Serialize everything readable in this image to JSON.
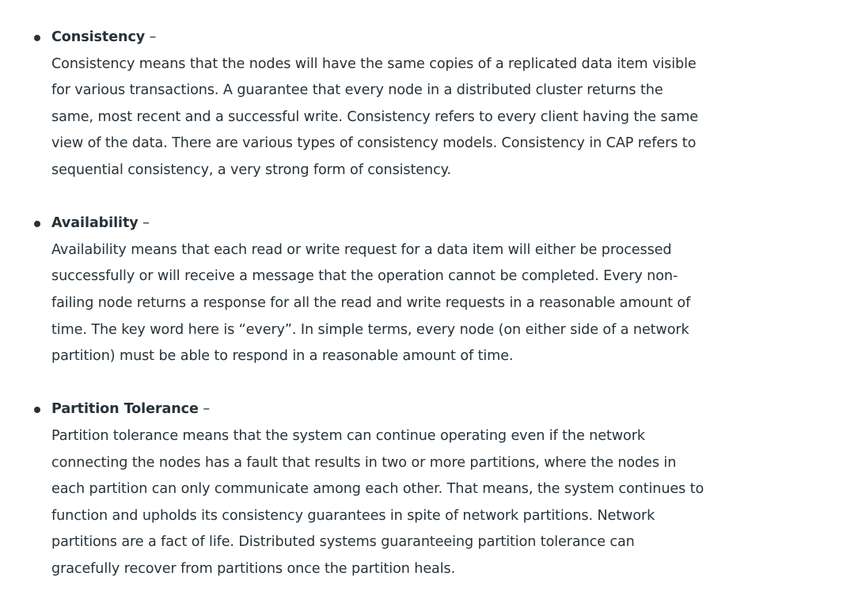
{
  "items": [
    {
      "title": "Consistency",
      "dash": " –",
      "lines": [
        "Consistency means that the nodes will have the same copies of a replicated data item visible",
        "for various transactions. A guarantee that every node in a distributed cluster returns the",
        "same, most recent and a successful write. Consistency refers to every client having the same",
        "view of the data. There are various types of consistency models. Consistency in CAP refers to",
        "sequential consistency, a very strong form of consistency."
      ]
    },
    {
      "title": "Availability",
      "dash": " –",
      "lines": [
        "Availability means that each read or write request for a data item will either be processed",
        "successfully or will receive a message that the operation cannot be completed. Every non-",
        "failing node returns a response for all the read and write requests in a reasonable amount of",
        "time. The key word here is “every”. In simple terms, every node (on either side of a network",
        "partition) must be able to respond in a reasonable amount of time."
      ]
    },
    {
      "title": "Partition Tolerance",
      "dash": " –",
      "lines": [
        "Partition tolerance means that the system can continue operating even if the network",
        "connecting the nodes has a fault that results in two or more partitions, where the nodes in",
        "each partition can only communicate among each other. That means, the system continues to",
        "function and upholds its consistency guarantees in spite of network partitions. Network",
        "partitions are a fact of life. Distributed systems guaranteeing partition tolerance can",
        "gracefully recover from partitions once the partition heals."
      ]
    }
  ]
}
